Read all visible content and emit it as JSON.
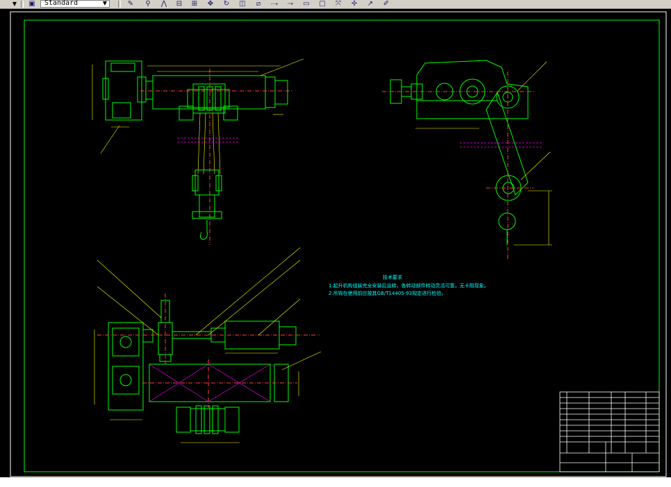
{
  "toolbar": {
    "text_style_value": "Standard",
    "icons": [
      "style-manager-icon",
      "edit-icon",
      "attach-icon",
      "mirror-icon",
      "array-icon",
      "grid-icon",
      "move-icon",
      "rotate-icon",
      "scale-icon",
      "stretch-icon",
      "trim-icon",
      "extend-icon",
      "break-icon",
      "rectangle-icon",
      "chamfer-icon",
      "explode-icon",
      "fillet-icon",
      "pencil-icon"
    ]
  },
  "drawing": {
    "notes_title": "技术要求",
    "note_1": "1.起升机构组装完全安装后运转，各转动部件转动灵活可靠，无卡阻现象。",
    "note_2": "2.吊钩在使用前应按其GB/T14405-93规定进行检验。"
  },
  "colors": {
    "background": "#000000",
    "frame": "#ffffff",
    "border": "#00ff00",
    "geometry": "#00ff00",
    "dimension": "#ffff00",
    "centerline": "#ff4040",
    "hidden": "#ff00ff",
    "text": "#00ffff"
  }
}
